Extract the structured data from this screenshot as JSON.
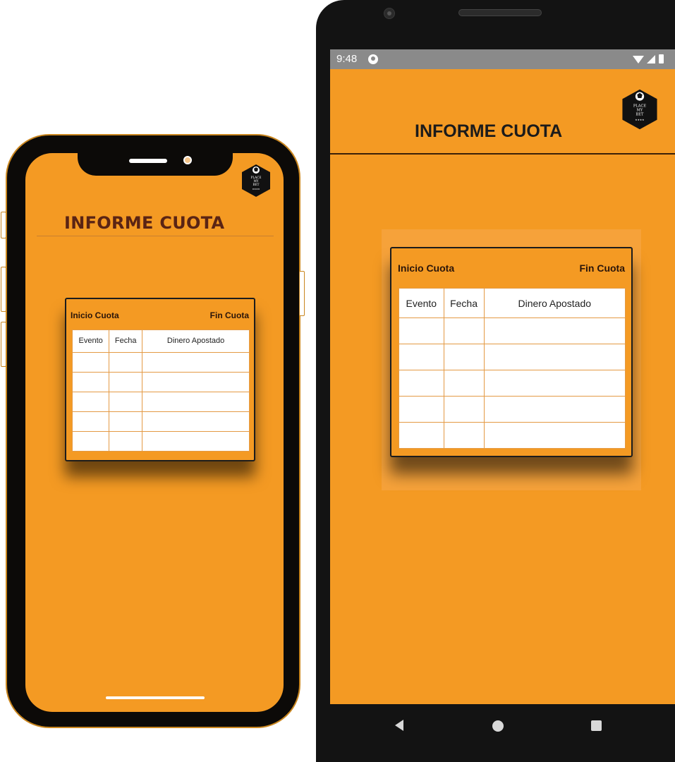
{
  "iphone": {
    "title": "INFORME CUOTA",
    "logo_text": "PLACE MY BET",
    "card": {
      "left_label": "Inicio Cuota",
      "right_label": "Fin Cuota",
      "columns": [
        "Evento",
        "Fecha",
        "Dinero Apostado"
      ],
      "row_count": 5
    }
  },
  "android": {
    "status_time": "9:48",
    "title": "INFORME CUOTA",
    "logo_text": "PLACE MY BET",
    "card": {
      "left_label": "Inicio Cuota",
      "right_label": "Fin Cuota",
      "columns": [
        "Evento",
        "Fecha",
        "Dinero Apostado"
      ],
      "row_count": 5
    },
    "nav": [
      "back-icon",
      "home-icon",
      "recents-icon"
    ]
  },
  "colors": {
    "background_orange": "#f49a23",
    "title_iphone": "#5a2414",
    "title_android": "#1b1b1b",
    "table_border": "#e49a44"
  }
}
